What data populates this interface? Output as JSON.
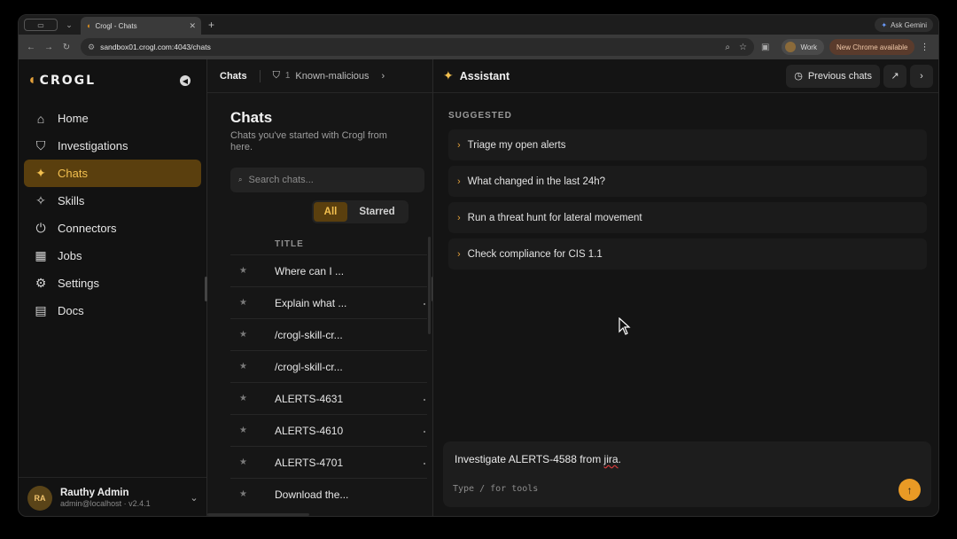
{
  "browser": {
    "tab_title": "Crogl - Chats",
    "new_tab": "+",
    "ask_gemini": "Ask Gemini",
    "url": "sandbox01.crogl.com:4043/chats",
    "profile_label": "Work",
    "update_label": "New Chrome available"
  },
  "sidebar": {
    "brand": "CROGL",
    "items": [
      {
        "label": "Home",
        "icon": "home-icon"
      },
      {
        "label": "Investigations",
        "icon": "shield-icon"
      },
      {
        "label": "Chats",
        "icon": "sparkles-icon",
        "active": true
      },
      {
        "label": "Skills",
        "icon": "wand-icon"
      },
      {
        "label": "Connectors",
        "icon": "plug-icon"
      },
      {
        "label": "Jobs",
        "icon": "calendar-clock-icon"
      },
      {
        "label": "Settings",
        "icon": "gear-icon"
      },
      {
        "label": "Docs",
        "icon": "document-icon"
      }
    ],
    "user": {
      "initials": "RA",
      "name": "Rauthy Admin",
      "email": "admin@localhost",
      "version": "v2.4.1"
    }
  },
  "middle": {
    "tabs": {
      "active": "Chats",
      "second_count": "1",
      "second_label": "Known-malicious"
    },
    "title": "Chats",
    "subtitle": "Chats you've started with Crogl from here.",
    "search_placeholder": "Search chats...",
    "filters": {
      "all": "All",
      "starred": "Starred"
    },
    "column_title": "TITLE",
    "rows": [
      "Where can I ...",
      "Explain what ...",
      "/crogl-skill-cr...",
      "/crogl-skill-cr...",
      "ALERTS-4631",
      "ALERTS-4610",
      "ALERTS-4701",
      "Download the..."
    ]
  },
  "assistant": {
    "title": "Assistant",
    "previous_chats": "Previous chats",
    "suggested_label": "SUGGESTED",
    "suggestions": [
      "Triage my open alerts",
      "What changed in the last 24h?",
      "Run a threat hunt for lateral movement",
      "Check compliance for CIS 1.1"
    ],
    "composer": {
      "text_before": "Investigate ALERTS-4588 from ",
      "text_misspelled": "jira",
      "text_after": ".",
      "hint": "Type / for tools"
    }
  },
  "colors": {
    "accent": "#f3c04f",
    "accent_bg": "#5a3f0e",
    "send_button": "#e99a25"
  }
}
